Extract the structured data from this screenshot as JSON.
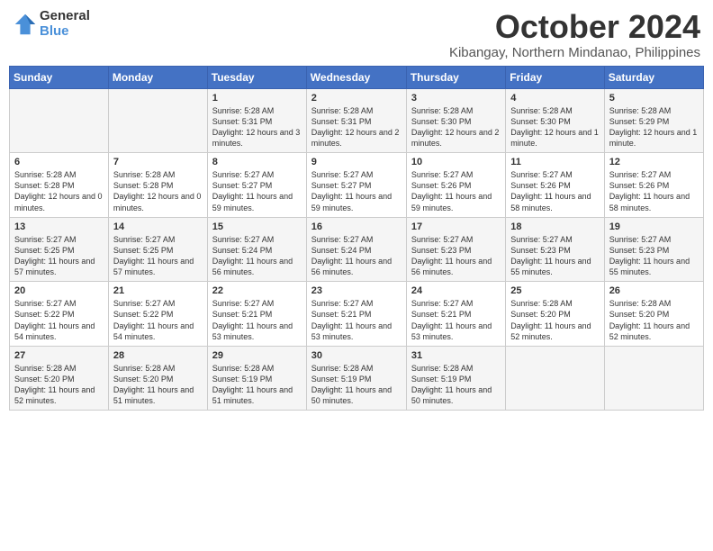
{
  "header": {
    "logo_general": "General",
    "logo_blue": "Blue",
    "month": "October 2024",
    "location": "Kibangay, Northern Mindanao, Philippines"
  },
  "days_of_week": [
    "Sunday",
    "Monday",
    "Tuesday",
    "Wednesday",
    "Thursday",
    "Friday",
    "Saturday"
  ],
  "weeks": [
    [
      {
        "day": "",
        "info": ""
      },
      {
        "day": "",
        "info": ""
      },
      {
        "day": "1",
        "info": "Sunrise: 5:28 AM\nSunset: 5:31 PM\nDaylight: 12 hours and 3 minutes."
      },
      {
        "day": "2",
        "info": "Sunrise: 5:28 AM\nSunset: 5:31 PM\nDaylight: 12 hours and 2 minutes."
      },
      {
        "day": "3",
        "info": "Sunrise: 5:28 AM\nSunset: 5:30 PM\nDaylight: 12 hours and 2 minutes."
      },
      {
        "day": "4",
        "info": "Sunrise: 5:28 AM\nSunset: 5:30 PM\nDaylight: 12 hours and 1 minute."
      },
      {
        "day": "5",
        "info": "Sunrise: 5:28 AM\nSunset: 5:29 PM\nDaylight: 12 hours and 1 minute."
      }
    ],
    [
      {
        "day": "6",
        "info": "Sunrise: 5:28 AM\nSunset: 5:28 PM\nDaylight: 12 hours and 0 minutes."
      },
      {
        "day": "7",
        "info": "Sunrise: 5:28 AM\nSunset: 5:28 PM\nDaylight: 12 hours and 0 minutes."
      },
      {
        "day": "8",
        "info": "Sunrise: 5:27 AM\nSunset: 5:27 PM\nDaylight: 11 hours and 59 minutes."
      },
      {
        "day": "9",
        "info": "Sunrise: 5:27 AM\nSunset: 5:27 PM\nDaylight: 11 hours and 59 minutes."
      },
      {
        "day": "10",
        "info": "Sunrise: 5:27 AM\nSunset: 5:26 PM\nDaylight: 11 hours and 59 minutes."
      },
      {
        "day": "11",
        "info": "Sunrise: 5:27 AM\nSunset: 5:26 PM\nDaylight: 11 hours and 58 minutes."
      },
      {
        "day": "12",
        "info": "Sunrise: 5:27 AM\nSunset: 5:26 PM\nDaylight: 11 hours and 58 minutes."
      }
    ],
    [
      {
        "day": "13",
        "info": "Sunrise: 5:27 AM\nSunset: 5:25 PM\nDaylight: 11 hours and 57 minutes."
      },
      {
        "day": "14",
        "info": "Sunrise: 5:27 AM\nSunset: 5:25 PM\nDaylight: 11 hours and 57 minutes."
      },
      {
        "day": "15",
        "info": "Sunrise: 5:27 AM\nSunset: 5:24 PM\nDaylight: 11 hours and 56 minutes."
      },
      {
        "day": "16",
        "info": "Sunrise: 5:27 AM\nSunset: 5:24 PM\nDaylight: 11 hours and 56 minutes."
      },
      {
        "day": "17",
        "info": "Sunrise: 5:27 AM\nSunset: 5:23 PM\nDaylight: 11 hours and 56 minutes."
      },
      {
        "day": "18",
        "info": "Sunrise: 5:27 AM\nSunset: 5:23 PM\nDaylight: 11 hours and 55 minutes."
      },
      {
        "day": "19",
        "info": "Sunrise: 5:27 AM\nSunset: 5:23 PM\nDaylight: 11 hours and 55 minutes."
      }
    ],
    [
      {
        "day": "20",
        "info": "Sunrise: 5:27 AM\nSunset: 5:22 PM\nDaylight: 11 hours and 54 minutes."
      },
      {
        "day": "21",
        "info": "Sunrise: 5:27 AM\nSunset: 5:22 PM\nDaylight: 11 hours and 54 minutes."
      },
      {
        "day": "22",
        "info": "Sunrise: 5:27 AM\nSunset: 5:21 PM\nDaylight: 11 hours and 53 minutes."
      },
      {
        "day": "23",
        "info": "Sunrise: 5:27 AM\nSunset: 5:21 PM\nDaylight: 11 hours and 53 minutes."
      },
      {
        "day": "24",
        "info": "Sunrise: 5:27 AM\nSunset: 5:21 PM\nDaylight: 11 hours and 53 minutes."
      },
      {
        "day": "25",
        "info": "Sunrise: 5:28 AM\nSunset: 5:20 PM\nDaylight: 11 hours and 52 minutes."
      },
      {
        "day": "26",
        "info": "Sunrise: 5:28 AM\nSunset: 5:20 PM\nDaylight: 11 hours and 52 minutes."
      }
    ],
    [
      {
        "day": "27",
        "info": "Sunrise: 5:28 AM\nSunset: 5:20 PM\nDaylight: 11 hours and 52 minutes."
      },
      {
        "day": "28",
        "info": "Sunrise: 5:28 AM\nSunset: 5:20 PM\nDaylight: 11 hours and 51 minutes."
      },
      {
        "day": "29",
        "info": "Sunrise: 5:28 AM\nSunset: 5:19 PM\nDaylight: 11 hours and 51 minutes."
      },
      {
        "day": "30",
        "info": "Sunrise: 5:28 AM\nSunset: 5:19 PM\nDaylight: 11 hours and 50 minutes."
      },
      {
        "day": "31",
        "info": "Sunrise: 5:28 AM\nSunset: 5:19 PM\nDaylight: 11 hours and 50 minutes."
      },
      {
        "day": "",
        "info": ""
      },
      {
        "day": "",
        "info": ""
      }
    ]
  ]
}
